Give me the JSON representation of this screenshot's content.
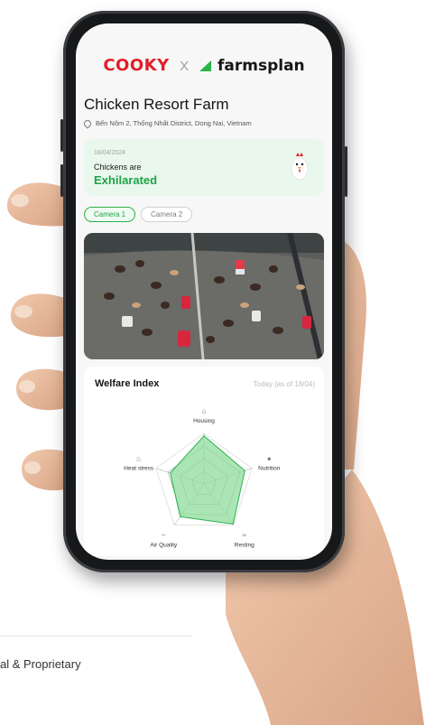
{
  "header": {
    "brand_left": "COOKY",
    "separator": "X",
    "brand_right": "farmsplan"
  },
  "farm": {
    "name": "Chicken Resort Farm",
    "address": "Bến Nôm 2, Thống Nhất District, Dong Nai, Vietnam"
  },
  "status": {
    "date": "18/04/2024",
    "label": "Chickens are",
    "mood": "Exhilarated"
  },
  "camera_tabs": [
    {
      "label": "Camera 1",
      "active": true
    },
    {
      "label": "Camera 2",
      "active": false
    }
  ],
  "welfare": {
    "title": "Welfare Index",
    "date_note": "Today (as of 18/04)",
    "axes": [
      {
        "label": "Housing",
        "icon": "house-icon",
        "value": 0.95
      },
      {
        "label": "Nutrition",
        "icon": "food-icon",
        "value": 0.85
      },
      {
        "label": "Resting",
        "icon": "bed-icon",
        "value": 0.98
      },
      {
        "label": "Air Quality",
        "icon": "air-icon",
        "value": 0.8
      },
      {
        "label": "Heat stress",
        "icon": "thermometer-icon",
        "value": 0.7
      }
    ]
  },
  "footer": {
    "text": "al & Proprietary"
  },
  "colors": {
    "accent": "#2bb34b",
    "brand_red": "#e11d2a",
    "mood_green": "#1ea34a"
  }
}
